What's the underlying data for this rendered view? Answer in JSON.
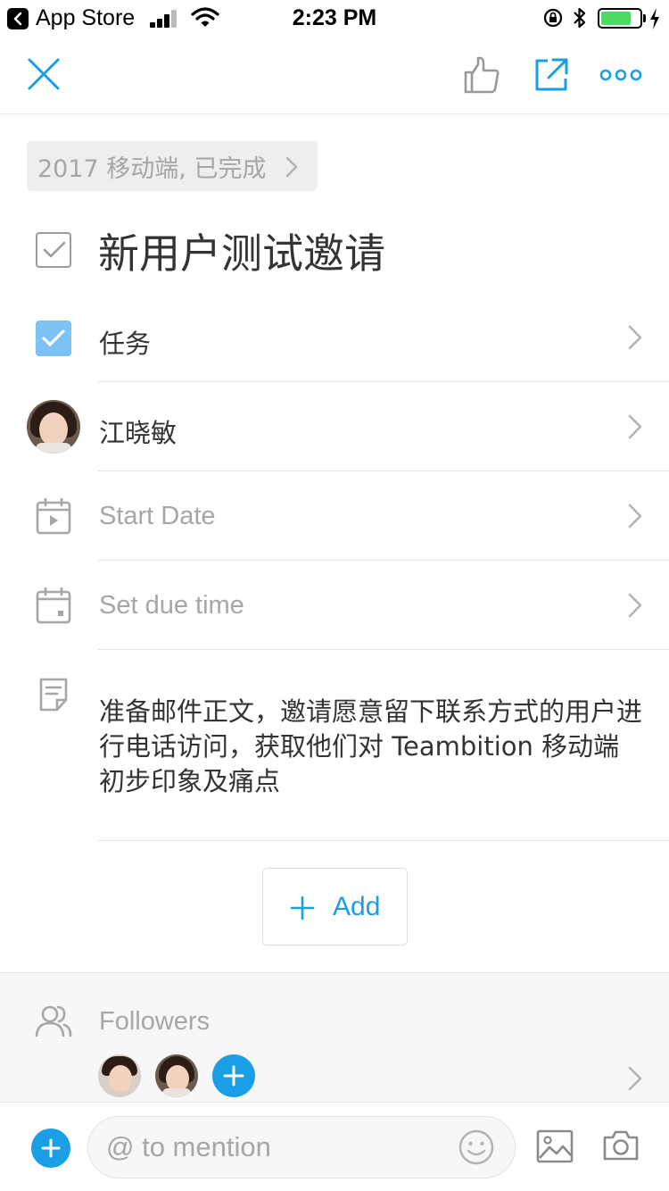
{
  "status_bar": {
    "back_app": "App Store",
    "time": "2:23 PM",
    "battery_level": 0.78
  },
  "nav": {
    "close_icon": "close-icon",
    "like_icon": "thumbs-up-icon",
    "share_icon": "open-external-icon",
    "more_icon": "more-icon"
  },
  "breadcrumb": {
    "text": "2017 移动端, 已完成"
  },
  "task": {
    "title": "新用户测试邀请",
    "done": true
  },
  "fields": {
    "type": "任务",
    "assignee": "江晓敏",
    "start_date": "Start Date",
    "due_time": "Set due time"
  },
  "note": {
    "text": "准备邮件正文，邀请愿意留下联系方式的用户进行电话访问，获取他们对 Teambition 移动端初步印象及痛点"
  },
  "add_button": {
    "label": "Add"
  },
  "followers": {
    "title": "Followers"
  },
  "comment": {
    "placeholder": "@ to mention"
  },
  "colors": {
    "accent": "#1a9ee6",
    "placeholder_gray": "#a6a6a6",
    "checkbox_blue": "#7cc2f4"
  }
}
